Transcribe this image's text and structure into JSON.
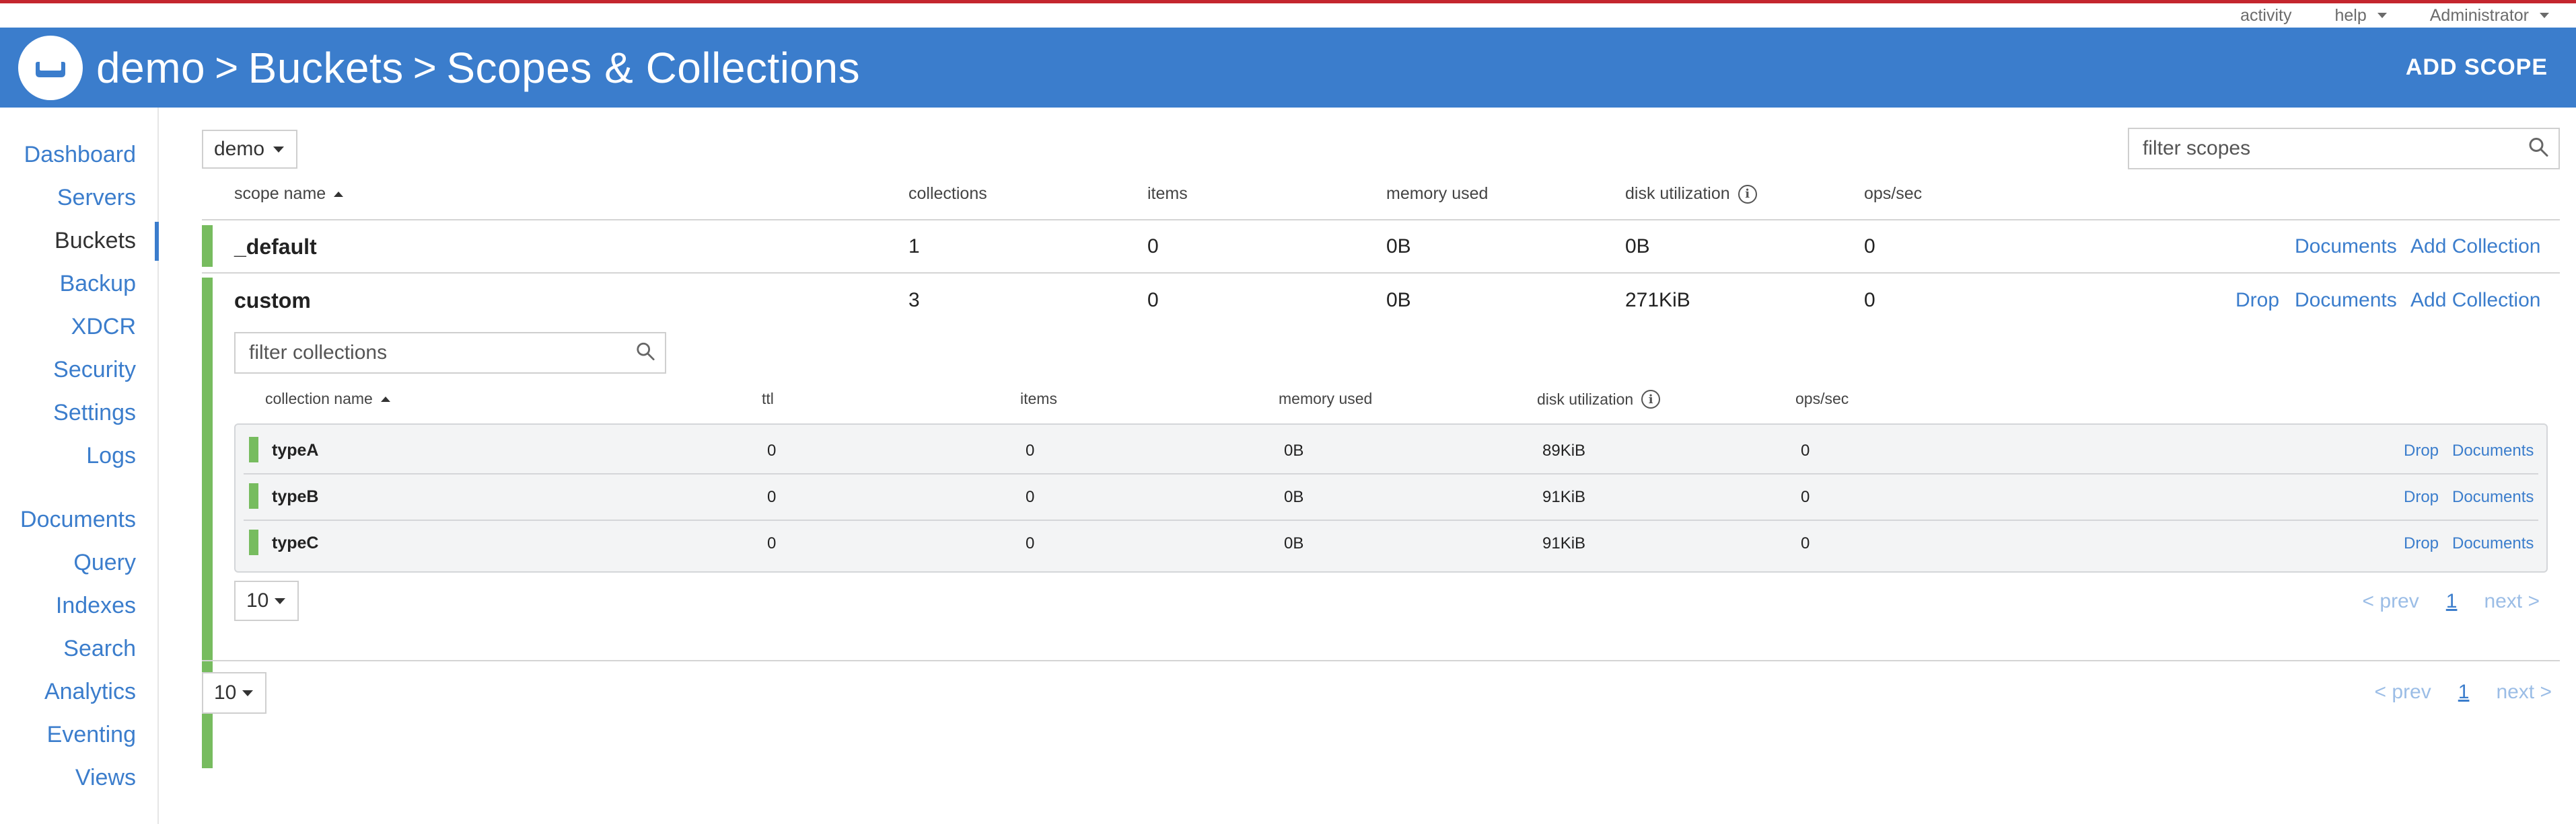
{
  "util_links": {
    "activity": "activity",
    "help": "help",
    "admin": "Administrator"
  },
  "breadcrumb": {
    "part1": "demo",
    "part2": "Buckets",
    "part3": "Scopes & Collections",
    "sep": ">"
  },
  "header": {
    "add_scope": "ADD SCOPE"
  },
  "sidebar": {
    "items": [
      "Dashboard",
      "Servers",
      "Buckets",
      "Backup",
      "XDCR",
      "Security",
      "Settings",
      "Logs",
      "Documents",
      "Query",
      "Indexes",
      "Search",
      "Analytics",
      "Eventing",
      "Views"
    ],
    "active": "Buckets"
  },
  "bucket_select": {
    "value": "demo"
  },
  "scope_filter": {
    "placeholder": "filter scopes"
  },
  "scope_columns": [
    "scope name",
    "collections",
    "items",
    "memory used",
    "disk utilization",
    "ops/sec"
  ],
  "scopes": [
    {
      "name": "_default",
      "collections": "1",
      "items": "0",
      "memory": "0B",
      "disk": "0B",
      "ops": "0",
      "actions": [
        "Documents",
        "Add Collection"
      ]
    },
    {
      "name": "custom",
      "collections": "3",
      "items": "0",
      "memory": "0B",
      "disk": "271KiB",
      "ops": "0",
      "actions": [
        "Drop",
        "Documents",
        "Add Collection"
      ]
    }
  ],
  "collection_filter": {
    "placeholder": "filter collections"
  },
  "collection_columns": [
    "collection name",
    "ttl",
    "items",
    "memory used",
    "disk utilization",
    "ops/sec"
  ],
  "collections": [
    {
      "name": "typeA",
      "ttl": "0",
      "items": "0",
      "memory": "0B",
      "disk": "89KiB",
      "ops": "0",
      "actions": [
        "Drop",
        "Documents"
      ]
    },
    {
      "name": "typeB",
      "ttl": "0",
      "items": "0",
      "memory": "0B",
      "disk": "91KiB",
      "ops": "0",
      "actions": [
        "Drop",
        "Documents"
      ]
    },
    {
      "name": "typeC",
      "ttl": "0",
      "items": "0",
      "memory": "0B",
      "disk": "91KiB",
      "ops": "0",
      "actions": [
        "Drop",
        "Documents"
      ]
    }
  ],
  "pagination": {
    "page_size": "10",
    "prev": "< prev",
    "page": "1",
    "next": "next >"
  },
  "colors": {
    "header_bg": "#3b7dcc",
    "accent_red": "#c4262e",
    "status_green": "#77bc5f",
    "link": "#3b7dcc"
  }
}
